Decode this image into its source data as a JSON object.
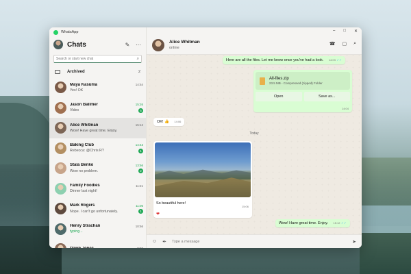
{
  "app": {
    "title": "WhatsApp"
  },
  "sidebar": {
    "title": "Chats",
    "search_placeholder": "Search or start new chat",
    "archived": {
      "label": "Archived",
      "count": "2"
    },
    "chats": [
      {
        "name": "Maya Kasuma",
        "time": "14:54",
        "preview": "Yes! OK",
        "unread": "",
        "avatar_color": "#7a5a48"
      },
      {
        "name": "Jason Ballmer",
        "time": "15:26",
        "preview": "Video",
        "unread": "5",
        "avatar_color": "#a07050"
      },
      {
        "name": "Alice Whitman",
        "time": "15:12",
        "preview": "Wow! Have great time. Enjoy.",
        "unread": "",
        "avatar_color": "#7d6656"
      },
      {
        "name": "Baking Club",
        "time": "14:43",
        "preview": "Rebecca: @Chris R?",
        "unread": "1",
        "avatar_color": "#b38f62"
      },
      {
        "name": "Stala Benko",
        "time": "13:56",
        "preview": "Wow no problem.",
        "unread": "2",
        "avatar_color": "#c7a48a"
      },
      {
        "name": "Family Foodies",
        "time": "11:21",
        "preview": "Dinner last night!",
        "unread": "",
        "avatar_color": "#8dd0b0"
      },
      {
        "name": "Mark Rogers",
        "time": "11:05",
        "preview": "Nope. I can't go unfortunately.",
        "unread": "1",
        "avatar_color": "#5e4a3e"
      },
      {
        "name": "Henry Strachan",
        "time": "10:56",
        "preview": "typing...",
        "unread": "",
        "avatar_color": "#4e6a6a"
      },
      {
        "name": "Dawn Jones",
        "time": "8:32",
        "preview": "",
        "unread": "",
        "avatar_color": "#8a6a58"
      }
    ]
  },
  "conversation": {
    "contact_name": "Alice Whitman",
    "contact_status": "online",
    "messages": {
      "m1": {
        "text": "Here are all the files. Let me know once you've had a look.",
        "time": "14:03"
      },
      "file": {
        "name": "All-files.zip",
        "meta": "23.5 MB - Compressed (zipped) Folder",
        "open_label": "Open",
        "save_label": "Save as...",
        "time": "14:04"
      },
      "m2": {
        "text": "OK! 👍",
        "time": "14:06"
      },
      "day_divider": "Today",
      "photo": {
        "caption": "So beautiful here!",
        "time": "15:06",
        "reaction": "❤"
      },
      "m3": {
        "text": "Wow! Have great time. Enjoy.",
        "time": "15:12"
      }
    },
    "composer_placeholder": "Type a message"
  },
  "icons": {
    "compose": "✎",
    "menu": "⋯",
    "search": "⌕",
    "call": "☎",
    "video": "▢",
    "emoji": "☺",
    "attach": "✒",
    "send": "➤",
    "min": "–",
    "max": "□",
    "close": "✕"
  }
}
